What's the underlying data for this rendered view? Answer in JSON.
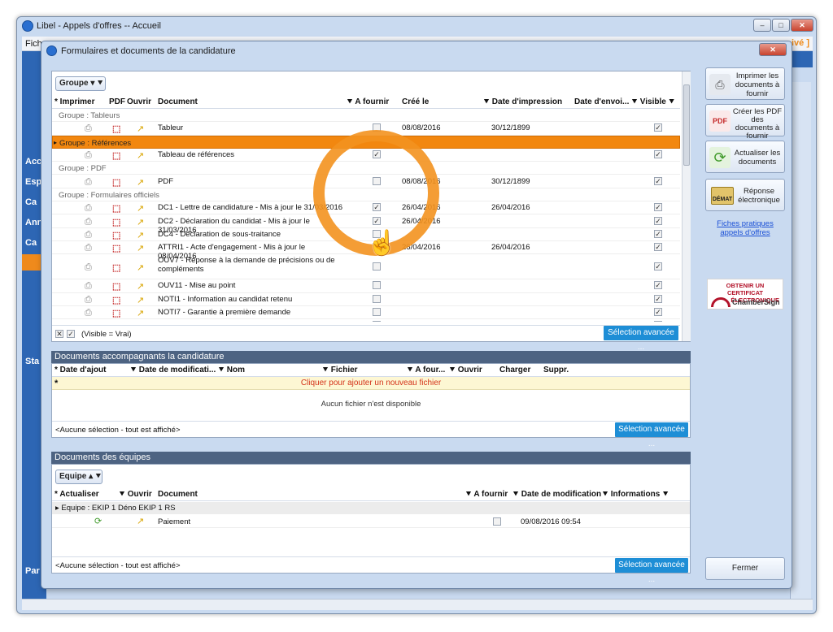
{
  "main_window": {
    "title": "Libel - Appels d'offres -- Accueil",
    "menu_partial": "Fich",
    "right_partial": "ivé ]"
  },
  "sidebar": {
    "items": [
      "Acc",
      "Esp",
      "Ca",
      "Ann",
      "Ca",
      "Sta",
      "Par"
    ]
  },
  "dialog": {
    "title": "Formulaires et documents de la candidature",
    "group_button": "Groupe",
    "columns": [
      "Imprimer",
      "PDF",
      "Ouvrir",
      "Document",
      "A fournir",
      "Créé le",
      "Date d'impression",
      "Date d'envoi...",
      "Visible"
    ],
    "groups": [
      {
        "name": "Groupe : Tableurs",
        "rows": [
          {
            "doc": "Tableur",
            "fournir": false,
            "cree": "08/08/2016",
            "impression": "30/12/1899",
            "visible": true
          }
        ]
      },
      {
        "name": "Groupe : Références",
        "highlight": true,
        "rows": [
          {
            "doc": "Tableau de références",
            "fournir": true,
            "cree": "",
            "impression": "",
            "visible": true
          }
        ]
      },
      {
        "name": "Groupe : PDF",
        "rows": [
          {
            "doc": "PDF",
            "fournir": false,
            "cree": "08/08/2016",
            "impression": "30/12/1899",
            "visible": true
          }
        ]
      },
      {
        "name": "Groupe : Formulaires officiels",
        "rows": [
          {
            "doc": "DC1 - Lettre de candidature - Mis à jour le 31/03/2016",
            "fournir": true,
            "cree": "26/04/2016",
            "impression": "26/04/2016",
            "visible": true
          },
          {
            "doc": "DC2 - Déclaration du candidat - Mis à jour le 31/03/2016",
            "fournir": true,
            "cree": "26/04/2016",
            "impression": "",
            "visible": true
          },
          {
            "doc": "DC4 - Déclaration de sous-traitance",
            "fournir": false,
            "cree": "",
            "impression": "",
            "visible": true
          },
          {
            "doc": "ATTRI1 - Acte d'engagement - Mis à jour le 08/04/2016",
            "fournir": false,
            "cree": "26/04/2016",
            "impression": "26/04/2016",
            "visible": true
          },
          {
            "doc": "OUV7 - Réponse à la demande de précisions ou de compléments",
            "fournir": false,
            "cree": "",
            "impression": "",
            "visible": true
          },
          {
            "doc": "OUV11 - Mise au point",
            "fournir": false,
            "cree": "",
            "impression": "",
            "visible": true
          },
          {
            "doc": "NOTI1 - Information au candidat retenu",
            "fournir": false,
            "cree": "",
            "impression": "",
            "visible": true
          },
          {
            "doc": "NOTI7 - Garantie à première demande",
            "fournir": false,
            "cree": "",
            "impression": "",
            "visible": true
          },
          {
            "doc": "NOTI8 - Caution personnelle et solidaire",
            "fournir": false,
            "cree": "",
            "impression": "",
            "visible": true
          }
        ]
      }
    ],
    "filter_text": "(Visible = Vrai)",
    "advanced": "Sélection avancée ..."
  },
  "accompanying": {
    "title": "Documents accompagnants la candidature",
    "columns": [
      "Date d'ajout",
      "Date de modificati...",
      "Nom",
      "Fichier",
      "A four...",
      "Ouvrir",
      "Charger",
      "Suppr."
    ],
    "add_row": "Cliquer pour ajouter un nouveau fichier",
    "empty": "Aucun fichier n'est disponible",
    "footer": "<Aucune sélection - tout est affiché>",
    "advanced": "Sélection avancée ..."
  },
  "teams": {
    "title": "Documents des équipes",
    "group_button": "Equipe",
    "columns": [
      "Actualiser",
      "Ouvrir",
      "Document",
      "A fournir",
      "Date de modification",
      "Informations"
    ],
    "group_row": "Equipe : EKIP 1 Déno EKIP 1 RS",
    "rows": [
      {
        "doc": "Paiement",
        "date": "09/08/2016 09:54"
      }
    ],
    "footer": "<Aucune sélection - tout est affiché>",
    "advanced": "Sélection avancée ..."
  },
  "right_panel": {
    "print_btn": "Imprimer les documents à fournir",
    "pdf_btn": "Créer les PDF des documents à fournir",
    "refresh_btn": "Actualiser les documents",
    "reply_btn": "Réponse électronique",
    "demat_label": "DÉMAT",
    "link": "Fiches pratiques appels d'offres",
    "cert_line1": "OBTENIR UN CERTIFICAT",
    "cert_line2": "ÉLECTRONIQUE",
    "cert_brand": "ChamberSign",
    "close_btn": "Fermer"
  }
}
